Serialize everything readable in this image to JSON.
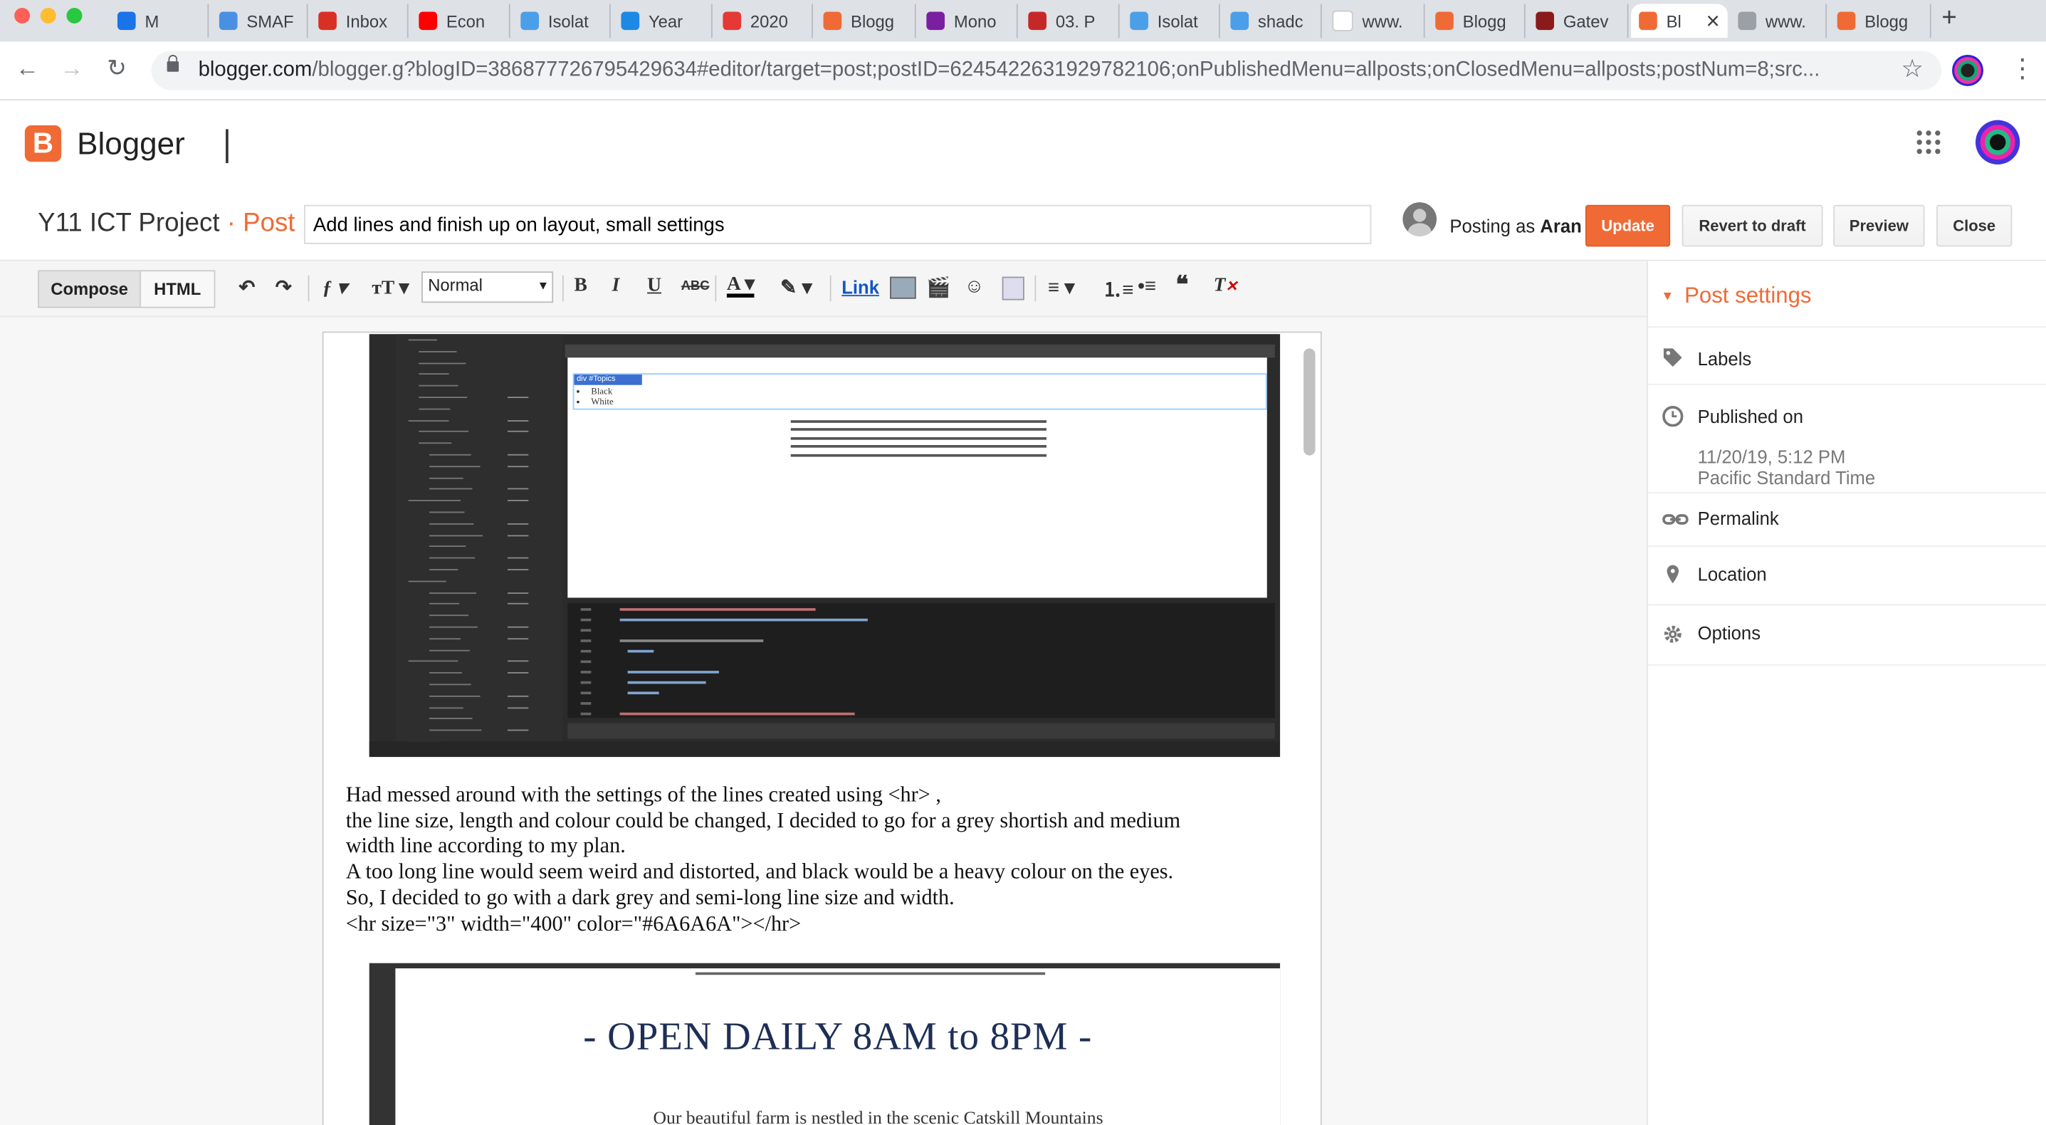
{
  "browser": {
    "tabs": [
      {
        "label": "M",
        "icon": "meet-icon",
        "color": "#1a73e8"
      },
      {
        "label": "SMAF",
        "icon": "smaf-icon",
        "color": "#4a90e2"
      },
      {
        "label": "Inbox",
        "icon": "gmail-icon",
        "color": "#d93025"
      },
      {
        "label": "Econ",
        "icon": "youtube-icon",
        "color": "#ff0000"
      },
      {
        "label": "Isolat",
        "icon": "page-icon",
        "color": "#4a9fe8"
      },
      {
        "label": "Year",
        "icon": "classroom-icon",
        "color": "#1e88e5"
      },
      {
        "label": "2020",
        "icon": "slides-icon",
        "color": "#e53935"
      },
      {
        "label": "Blogg",
        "icon": "blogger-icon",
        "color": "#f06a35"
      },
      {
        "label": "Mono",
        "icon": "forms-icon",
        "color": "#7b1fa2"
      },
      {
        "label": "03. P",
        "icon": "calendar-icon",
        "color": "#c62828"
      },
      {
        "label": "Isolat",
        "icon": "page-icon",
        "color": "#4a9fe8"
      },
      {
        "label": "shadc",
        "icon": "page-icon",
        "color": "#4a9fe8"
      },
      {
        "label": "www.",
        "icon": "google-icon",
        "color": "#ffffff"
      },
      {
        "label": "Blogg",
        "icon": "blogger-icon",
        "color": "#f06a35"
      },
      {
        "label": "Gatev",
        "icon": "school-icon",
        "color": "#8b1a1a"
      },
      {
        "label": "Bl",
        "icon": "blogger-icon",
        "color": "#f06a35"
      },
      {
        "label": "www.",
        "icon": "page-icon",
        "color": "#9aa0a6"
      },
      {
        "label": "Blogg",
        "icon": "blogger-icon",
        "color": "#f06a35"
      }
    ],
    "url_host": "blogger.com",
    "url_rest": "/blogger.g?blogID=3868777267954296​34#editor/target=post;postID=6245422631929782106;onPublishedMenu=allposts;onClosedMenu=allposts;postNum=8;src..."
  },
  "app": {
    "name": "Blogger"
  },
  "post": {
    "blog_title": "Y11 ICT Project",
    "separator": " · ",
    "section": "Post",
    "title_value": "Add lines and finish up on layout, small settings",
    "posting_as_prefix": "Posting as ",
    "posting_as_user": "Aran",
    "buttons": {
      "update": "Update",
      "revert": "Revert to draft",
      "preview": "Preview",
      "close": "Close"
    }
  },
  "toolbar": {
    "compose": "Compose",
    "html": "HTML",
    "format": "Normal",
    "link": "Link"
  },
  "settings": {
    "title": "Post settings",
    "labels": "Labels",
    "published_on": "Published on",
    "published_date": "11/20/19, 5:12 PM",
    "published_tz": "Pacific Standard Time",
    "permalink": "Permalink",
    "location": "Location",
    "options": "Options"
  },
  "content": {
    "paragraph": [
      "Had messed around with the settings of the lines created using <hr> ,",
      "the line size, length and colour could be changed, I decided to go for a grey shortish and medium",
      "width line according to my plan.",
      "A too long line would seem weird and distorted, and black would be a heavy colour on the eyes.",
      "So, I decided to go with a dark grey and semi-long line size and width.",
      "<hr size=\"3\" width=\"400\" color=\"#6A6A6A\"></hr>"
    ],
    "shot1": {
      "list_items": [
        "Black",
        "White"
      ],
      "tag_label": "div #Topics"
    },
    "shot2": {
      "heading": "- OPEN DAILY 8AM to 8PM -",
      "cut_text": "Our beautiful farm is nestled in the scenic Catskill Mountains"
    }
  },
  "colors": {
    "accent": "#f06a35",
    "hr_color": "#6A6A6A"
  }
}
